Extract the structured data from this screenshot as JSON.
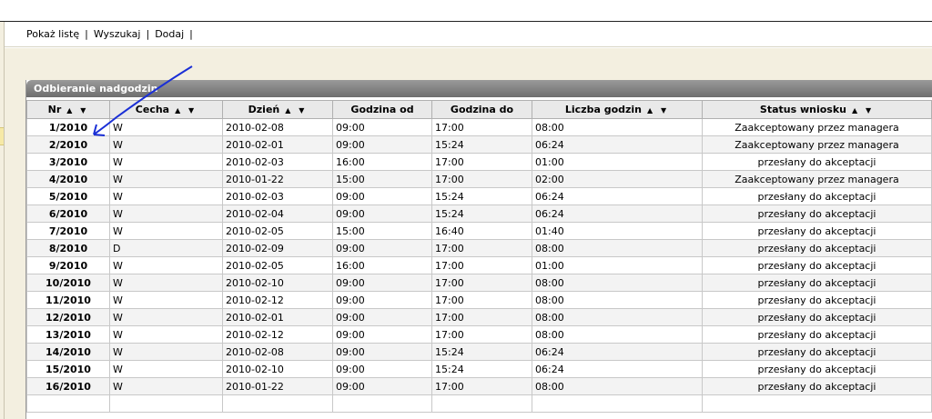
{
  "toolbar": {
    "show_list": "Pokaż listę",
    "search": "Wyszukaj",
    "add": "Dodaj",
    "separator": "|"
  },
  "panel": {
    "title": "Odbieranie nadgodzin"
  },
  "table": {
    "columns": [
      "Nr",
      "Cecha",
      "Dzień",
      "Godzina od",
      "Godzina do",
      "Liczba godzin",
      "Status wniosku"
    ],
    "sort_glyph": "▲ ▼",
    "rows": [
      {
        "nr": "1/2010",
        "cecha": "W",
        "dzien": "2010-02-08",
        "od": "09:00",
        "do": "17:00",
        "liczba": "08:00",
        "status": "Zaakceptowany przez managera"
      },
      {
        "nr": "2/2010",
        "cecha": "W",
        "dzien": "2010-02-01",
        "od": "09:00",
        "do": "15:24",
        "liczba": "06:24",
        "status": "Zaakceptowany przez managera"
      },
      {
        "nr": "3/2010",
        "cecha": "W",
        "dzien": "2010-02-03",
        "od": "16:00",
        "do": "17:00",
        "liczba": "01:00",
        "status": "przesłany do akceptacji"
      },
      {
        "nr": "4/2010",
        "cecha": "W",
        "dzien": "2010-01-22",
        "od": "15:00",
        "do": "17:00",
        "liczba": "02:00",
        "status": "Zaakceptowany przez managera"
      },
      {
        "nr": "5/2010",
        "cecha": "W",
        "dzien": "2010-02-03",
        "od": "09:00",
        "do": "15:24",
        "liczba": "06:24",
        "status": "przesłany do akceptacji"
      },
      {
        "nr": "6/2010",
        "cecha": "W",
        "dzien": "2010-02-04",
        "od": "09:00",
        "do": "15:24",
        "liczba": "06:24",
        "status": "przesłany do akceptacji"
      },
      {
        "nr": "7/2010",
        "cecha": "W",
        "dzien": "2010-02-05",
        "od": "15:00",
        "do": "16:40",
        "liczba": "01:40",
        "status": "przesłany do akceptacji"
      },
      {
        "nr": "8/2010",
        "cecha": "D",
        "dzien": "2010-02-09",
        "od": "09:00",
        "do": "17:00",
        "liczba": "08:00",
        "status": "przesłany do akceptacji"
      },
      {
        "nr": "9/2010",
        "cecha": "W",
        "dzien": "2010-02-05",
        "od": "16:00",
        "do": "17:00",
        "liczba": "01:00",
        "status": "przesłany do akceptacji"
      },
      {
        "nr": "10/2010",
        "cecha": "W",
        "dzien": "2010-02-10",
        "od": "09:00",
        "do": "17:00",
        "liczba": "08:00",
        "status": "przesłany do akceptacji"
      },
      {
        "nr": "11/2010",
        "cecha": "W",
        "dzien": "2010-02-12",
        "od": "09:00",
        "do": "17:00",
        "liczba": "08:00",
        "status": "przesłany do akceptacji"
      },
      {
        "nr": "12/2010",
        "cecha": "W",
        "dzien": "2010-02-01",
        "od": "09:00",
        "do": "17:00",
        "liczba": "08:00",
        "status": "przesłany do akceptacji"
      },
      {
        "nr": "13/2010",
        "cecha": "W",
        "dzien": "2010-02-12",
        "od": "09:00",
        "do": "17:00",
        "liczba": "08:00",
        "status": "przesłany do akceptacji"
      },
      {
        "nr": "14/2010",
        "cecha": "W",
        "dzien": "2010-02-08",
        "od": "09:00",
        "do": "15:24",
        "liczba": "06:24",
        "status": "przesłany do akceptacji"
      },
      {
        "nr": "15/2010",
        "cecha": "W",
        "dzien": "2010-02-10",
        "od": "09:00",
        "do": "15:24",
        "liczba": "06:24",
        "status": "przesłany do akceptacji"
      },
      {
        "nr": "16/2010",
        "cecha": "W",
        "dzien": "2010-01-22",
        "od": "09:00",
        "do": "17:00",
        "liczba": "08:00",
        "status": "przesłany do akceptacji"
      },
      {
        "nr": "",
        "cecha": "",
        "dzien": "",
        "od": "",
        "do": "",
        "liczba": "",
        "status": ""
      }
    ]
  },
  "colors": {
    "header_bar": "#7a7a7a",
    "annotation_arrow": "#1a2fd6",
    "background": "#f3efe0"
  },
  "annotation": {
    "icon": "arrow-annotation-icon"
  }
}
